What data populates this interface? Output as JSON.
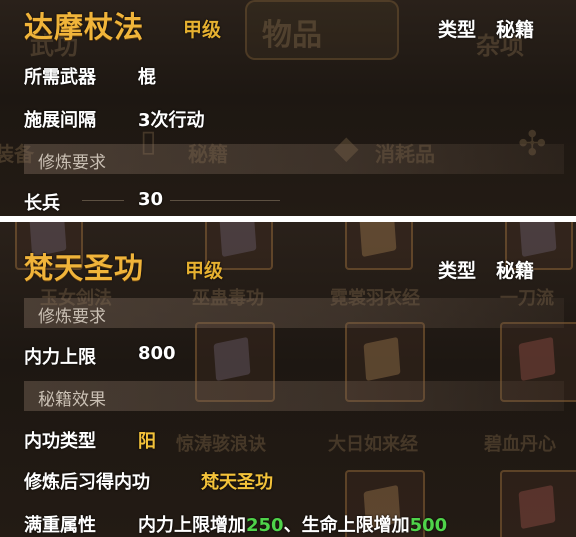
{
  "top": {
    "title": "达摩杖法",
    "grade": "甲级",
    "type_label": "类型",
    "type_value": "秘籍",
    "rows": [
      {
        "label": "所需武器",
        "value": "棍"
      },
      {
        "label": "施展间隔",
        "value": "3次行动"
      }
    ],
    "section": "修炼要求",
    "requirement": {
      "label": "长兵",
      "value": "30"
    },
    "background": {
      "tab_items": "物品",
      "tab_left": "武功",
      "tab_right": "杂项",
      "filter_equip": "装备",
      "filter_manual": "秘籍",
      "filter_consumable": "消耗品"
    }
  },
  "bottom": {
    "title": "梵天圣功",
    "grade": "甲级",
    "type_label": "类型",
    "type_value": "秘籍",
    "section1": "修炼要求",
    "inner_limit": {
      "label": "内力上限",
      "value": "800"
    },
    "section2": "秘籍效果",
    "inner_type": {
      "label": "内功类型",
      "value": "阳"
    },
    "gain": {
      "label": "修炼后习得内功",
      "value": "梵天圣功"
    },
    "full": {
      "label": "满重属性",
      "part1": "内力上限增加",
      "num1": "250",
      "sep": "、",
      "part2": "生命上限增加",
      "num2": "500"
    },
    "background": {
      "item1": "玉女剑法",
      "item2": "巫蛊毒功",
      "item3": "霓裳羽衣经",
      "item4": "一刀流",
      "item5": "惊涛骇浪诀",
      "item6": "大日如来经",
      "item7": "碧血丹心"
    }
  }
}
